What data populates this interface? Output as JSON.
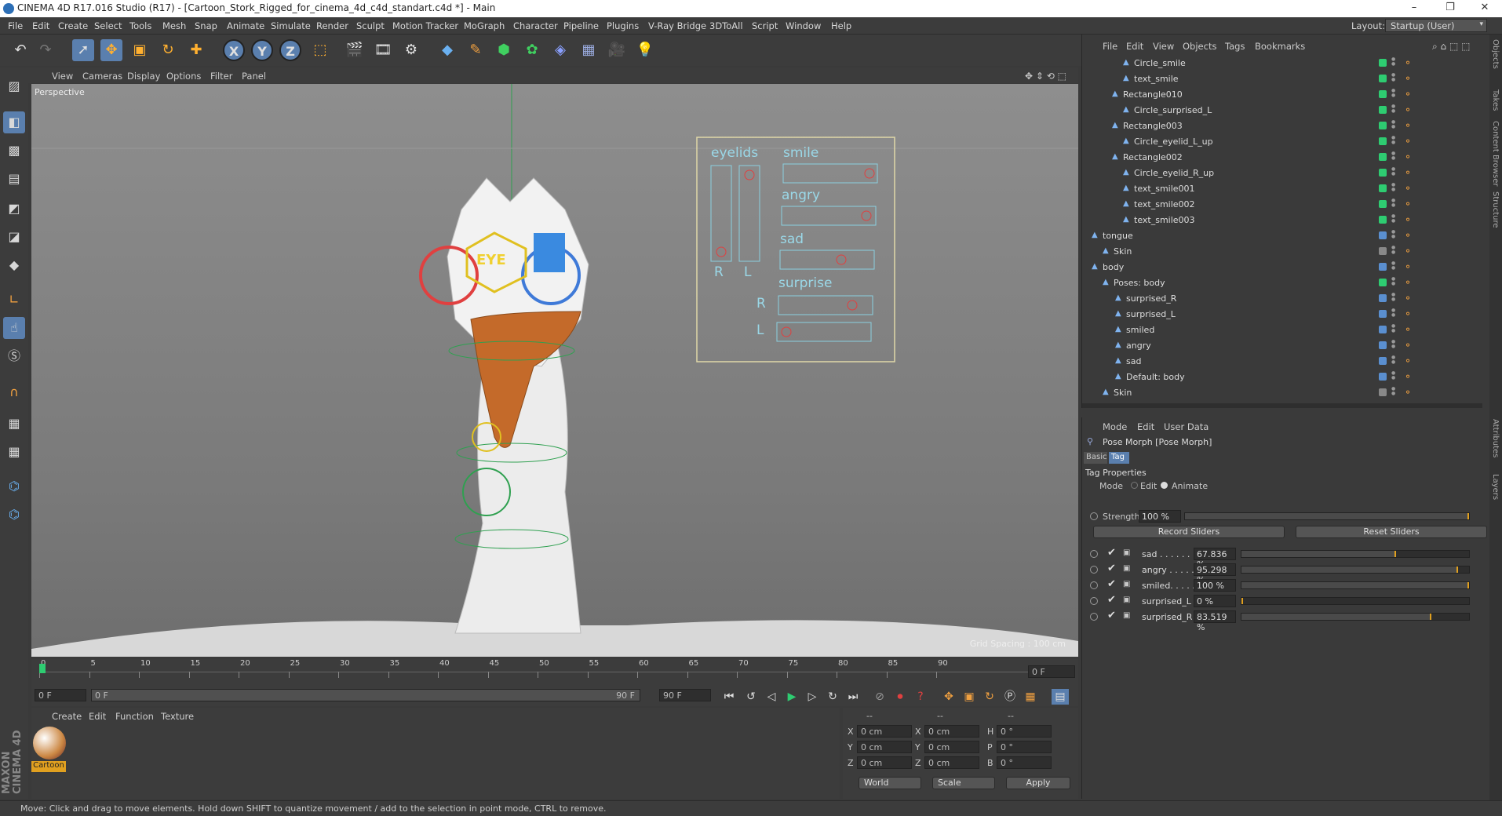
{
  "window": {
    "title": "CINEMA 4D R17.016 Studio (R17) - [Cartoon_Stork_Rigged_for_cinema_4d_c4d_standart.c4d *] - Main",
    "minimize": "–",
    "maximize": "❐",
    "close": "✕"
  },
  "menubar": {
    "items": [
      "File",
      "Edit",
      "Create",
      "Select",
      "Tools",
      "Mesh",
      "Snap",
      "Animate",
      "Simulate",
      "Render",
      "Sculpt",
      "Motion Tracker",
      "MoGraph",
      "Character",
      "Pipeline",
      "Plugins",
      "V-Ray Bridge",
      "3DToAll",
      "Script",
      "Window",
      "Help"
    ],
    "layout_label": "Layout:",
    "layout_value": "Startup (User)"
  },
  "toolbar": {
    "x_axis": "X",
    "y_axis": "Y",
    "z_axis": "Z"
  },
  "viewport": {
    "menu": [
      "View",
      "Cameras",
      "Display",
      "Options",
      "Filter",
      "Panel"
    ],
    "label": "Perspective",
    "grid_spacing": "Grid Spacing : 100 cm",
    "face_panel": {
      "eyelids": "eyelids",
      "smile": "smile",
      "angry": "angry",
      "sad": "sad",
      "surprise": "surprise",
      "r": "R",
      "l": "L",
      "r2": "R",
      "l2": "L"
    },
    "eye_text": "EYE"
  },
  "timeline": {
    "ticks": [
      "0",
      "5",
      "10",
      "15",
      "20",
      "25",
      "30",
      "35",
      "40",
      "45",
      "50",
      "55",
      "60",
      "65",
      "70",
      "75",
      "80",
      "85",
      "90"
    ],
    "current_frame_right": "0 F"
  },
  "transport": {
    "start_field": "0 F",
    "range_start": "0 F",
    "range_end": "90 F",
    "end_field": "90 F"
  },
  "material_manager": {
    "menu": [
      "Create",
      "Edit",
      "Function",
      "Texture"
    ],
    "material_name": "Cartoon"
  },
  "coord_manager": {
    "headers": [
      "--",
      "--",
      "--"
    ],
    "rows": [
      {
        "a": "X",
        "av": "0 cm",
        "b": "X",
        "bv": "0 cm",
        "c": "H",
        "cv": "0 °"
      },
      {
        "a": "Y",
        "av": "0 cm",
        "b": "Y",
        "bv": "0 cm",
        "c": "P",
        "cv": "0 °"
      },
      {
        "a": "Z",
        "av": "0 cm",
        "b": "Z",
        "bv": "0 cm",
        "c": "B",
        "cv": "0 °"
      }
    ],
    "world": "World",
    "scale": "Scale",
    "apply": "Apply"
  },
  "status": "Move: Click and drag to move elements. Hold down SHIFT to quantize movement / add to the selection in point mode, CTRL to remove.",
  "object_manager": {
    "menu": [
      "File",
      "Edit",
      "View",
      "Objects",
      "Tags",
      "Bookmarks"
    ],
    "rows": [
      {
        "name": "Circle_smile",
        "color": "#2ecc71"
      },
      {
        "name": "text_smile",
        "color": "#2ecc71"
      },
      {
        "name": "Rectangle010",
        "color": "#2ecc71"
      },
      {
        "name": "Circle_surprised_L",
        "color": "#2ecc71"
      },
      {
        "name": "Rectangle003",
        "color": "#2ecc71"
      },
      {
        "name": "Circle_eyelid_L_up",
        "color": "#2ecc71"
      },
      {
        "name": "Rectangle002",
        "color": "#2ecc71"
      },
      {
        "name": "Circle_eyelid_R_up",
        "color": "#2ecc71"
      },
      {
        "name": "text_smile001",
        "color": "#2ecc71"
      },
      {
        "name": "text_smile002",
        "color": "#2ecc71"
      },
      {
        "name": "text_smile003",
        "color": "#2ecc71"
      },
      {
        "name": "tongue",
        "color": "#5a8fd0"
      },
      {
        "name": "Skin",
        "color": "#888888"
      },
      {
        "name": "body",
        "color": "#5a8fd0"
      },
      {
        "name": "Poses: body",
        "color": "#2ecc71"
      },
      {
        "name": "surprised_R",
        "color": "#5a8fd0"
      },
      {
        "name": "surprised_L",
        "color": "#5a8fd0"
      },
      {
        "name": "smiled",
        "color": "#5a8fd0"
      },
      {
        "name": "angry",
        "color": "#5a8fd0"
      },
      {
        "name": "sad",
        "color": "#5a8fd0"
      },
      {
        "name": "Default: body",
        "color": "#5a8fd0"
      },
      {
        "name": "Skin",
        "color": "#888888"
      }
    ]
  },
  "attributes": {
    "menu": [
      "Mode",
      "Edit",
      "User Data"
    ],
    "title": "Pose Morph [Pose Morph]",
    "tabs": [
      "Basic",
      "Tag"
    ],
    "section": "Tag Properties",
    "mode_label": "Mode",
    "mode_edit": "Edit",
    "mode_animate": "Animate",
    "strength_label": "Strength",
    "strength_value": "100 %",
    "strength_fraction": 1.0,
    "record_sliders": "Record Sliders",
    "reset_sliders": "Reset Sliders",
    "sliders": [
      {
        "label": "sad . . . . . . .",
        "value": "67.836 %",
        "fraction": 0.678
      },
      {
        "label": "angry . . . . .",
        "value": "95.298 %",
        "fraction": 0.953
      },
      {
        "label": "smiled. . . . .",
        "value": "100 %",
        "fraction": 1.0
      },
      {
        "label": "surprised_L",
        "value": "0 %",
        "fraction": 0.0
      },
      {
        "label": "surprised_R",
        "value": "83.519 %",
        "fraction": 0.835
      }
    ]
  },
  "right_tabs": [
    "Objects",
    "Takes",
    "Content Browser",
    "Structure",
    "Attributes",
    "Layers"
  ],
  "maxon_logo": "MAXON CINEMA 4D"
}
